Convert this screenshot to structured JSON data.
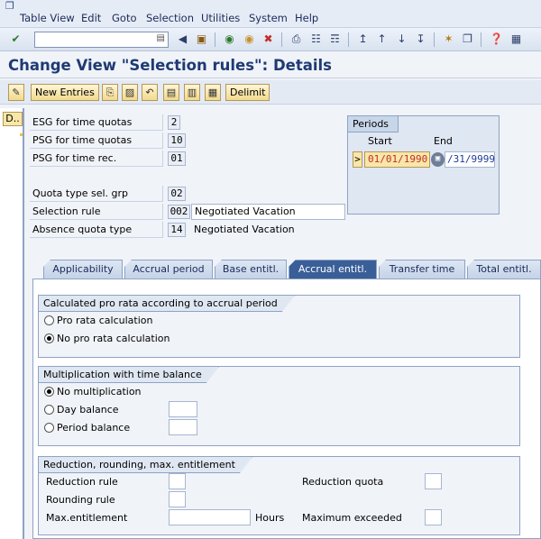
{
  "menu": {
    "items": [
      "Table View",
      "Edit",
      "Goto",
      "Selection",
      "Utilities",
      "System",
      "Help"
    ]
  },
  "toolbar": {
    "command_value": "",
    "icons": [
      "enter-icon",
      "back-icon",
      "save-icon",
      "nav-back-icon",
      "exit-icon",
      "cancel-icon",
      "print-icon",
      "find-icon",
      "find-next-icon",
      "first-page-icon",
      "prev-page-icon",
      "next-page-icon",
      "last-page-icon",
      "create-session-icon",
      "shortcut-icon",
      "help-icon",
      "layout-icon"
    ]
  },
  "page": {
    "title": "Change View \"Selection rules\": Details"
  },
  "app_toolbar": {
    "new_entries": "New Entries",
    "delimit": "Delimit"
  },
  "left_nav": {
    "top_label": "D.."
  },
  "fields": {
    "esg_label": "ESG for time quotas",
    "esg_value": "2",
    "psg_quota_label": "PSG for time quotas",
    "psg_quota_value": "10",
    "psg_rec_label": "PSG for time rec.",
    "psg_rec_value": "01",
    "quota_type_label": "Quota type sel. grp",
    "quota_type_value": "02",
    "selection_rule_label": "Selection rule",
    "selection_rule_value": "002",
    "selection_rule_text": "Negotiated Vacation",
    "absence_quota_label": "Absence quota type",
    "absence_quota_value": "14",
    "absence_quota_text": "Negotiated Vacation"
  },
  "periods": {
    "header": "Periods",
    "start_label": "Start",
    "end_label": "End",
    "start_value": "01/01/1990",
    "end_value": "/31/9999",
    "marker": ">"
  },
  "tabs": [
    "Applicability",
    "Accrual period",
    "Base entitl.",
    "Accrual entitl.",
    "Transfer time",
    "Total entitl."
  ],
  "active_tab": "Accrual entitl.",
  "group_prorata": {
    "header": "Calculated pro rata according to accrual period",
    "option1": "Pro rata calculation",
    "option2": "No pro rata calculation",
    "selected": "No pro rata calculation"
  },
  "group_mult": {
    "header": "Multiplication with time balance",
    "option1": "No multiplication",
    "option2": "Day balance",
    "option3": "Period balance",
    "selected": "No multiplication"
  },
  "group_reduction": {
    "header": "Reduction, rounding, max. entitlement",
    "reduction_rule": "Reduction rule",
    "rounding_rule": "Rounding rule",
    "max_entitlement": "Max.entitlement",
    "hours": "Hours",
    "reduction_quota": "Reduction quota",
    "maximum_exceeded": "Maximum exceeded"
  }
}
